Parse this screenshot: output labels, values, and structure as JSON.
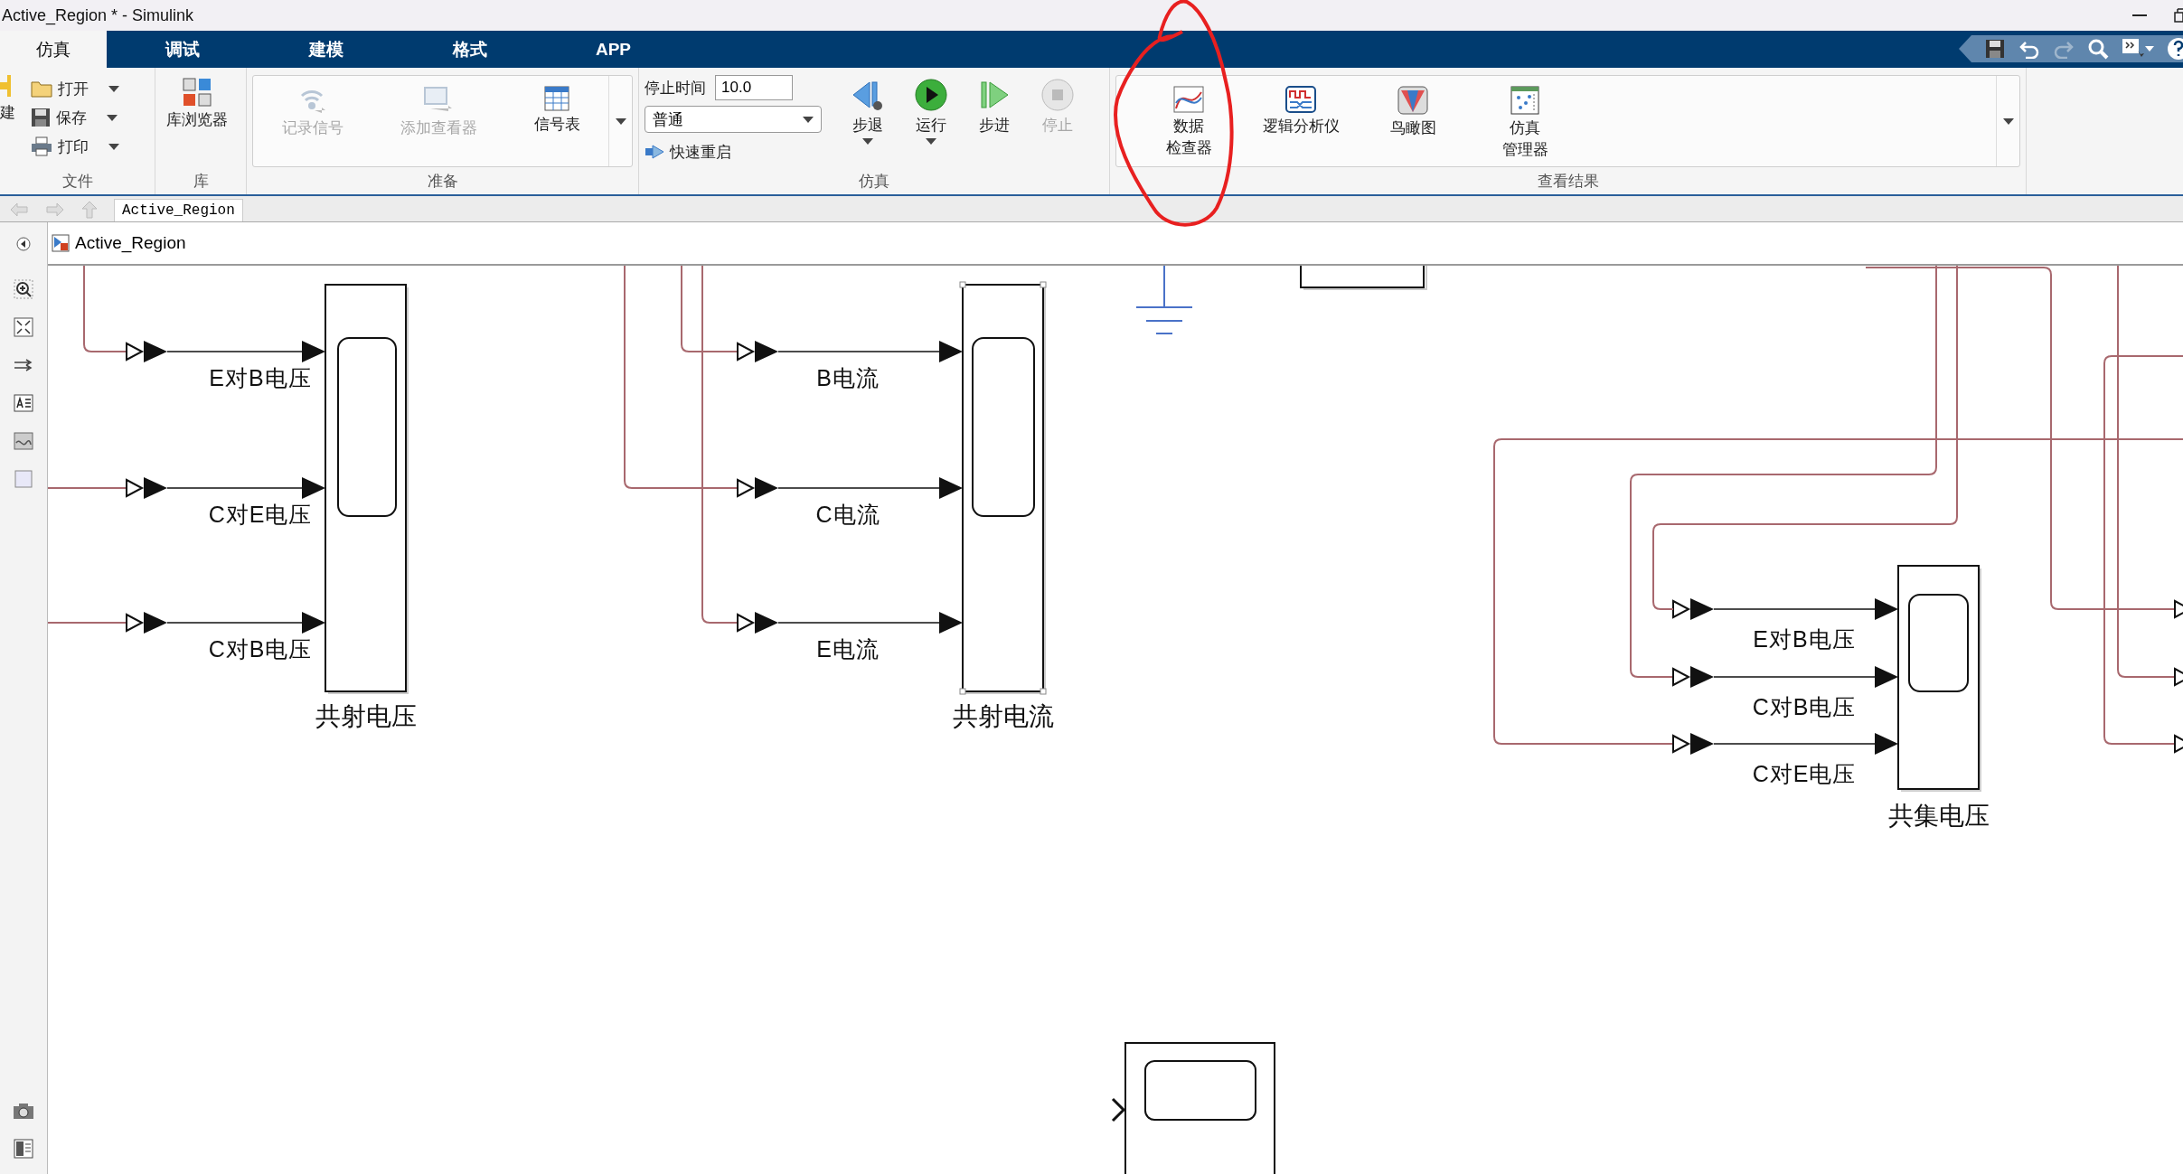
{
  "window": {
    "title": "Active_Region * - Simulink"
  },
  "tabs": [
    {
      "label": "仿真",
      "selected": true
    },
    {
      "label": "调试",
      "selected": false
    },
    {
      "label": "建模",
      "selected": false
    },
    {
      "label": "格式",
      "selected": false
    },
    {
      "label": "APP",
      "selected": false
    }
  ],
  "ribbon": {
    "groups": [
      {
        "kind": "file",
        "title": "文件",
        "new_label": "建",
        "items": [
          {
            "label": "打开",
            "kind": "open"
          },
          {
            "label": "保存",
            "kind": "save"
          },
          {
            "label": "打印",
            "kind": "print"
          }
        ]
      },
      {
        "kind": "large",
        "title": "库",
        "items": [
          {
            "label": "库浏览器",
            "kind": "library",
            "disabled": false
          }
        ]
      },
      {
        "kind": "gallery",
        "title": "准备",
        "items": [
          {
            "label": "记录信号",
            "kind": "record",
            "disabled": true
          },
          {
            "label": "添加查看器",
            "kind": "viewer",
            "disabled": true
          },
          {
            "label": "信号表",
            "kind": "table",
            "disabled": false
          }
        ]
      },
      {
        "kind": "simulation",
        "title": "仿真",
        "stop_time_label": "停止时间",
        "stop_time": "10.0",
        "mode": "普通",
        "fast_restart": "快速重启",
        "items": [
          {
            "label": "步退",
            "kind": "stepback",
            "disabled": false,
            "has_menu": true
          },
          {
            "label": "运行",
            "kind": "run",
            "disabled": false,
            "has_menu": true
          },
          {
            "label": "步进",
            "kind": "stepfwd",
            "disabled": false,
            "has_menu": false
          },
          {
            "label": "停止",
            "kind": "stop",
            "disabled": true,
            "has_menu": false
          }
        ]
      },
      {
        "kind": "gallery",
        "title": "查看结果",
        "items": [
          {
            "lines": [
              "数据",
              "检查器"
            ],
            "kind": "inspector",
            "disabled": false
          },
          {
            "lines": [
              "逻辑分析仪"
            ],
            "kind": "analyzer",
            "disabled": false
          },
          {
            "lines": [
              "鸟瞰图"
            ],
            "kind": "birdseye",
            "disabled": false
          },
          {
            "lines": [
              "仿真",
              "管理器"
            ],
            "kind": "manager",
            "disabled": false
          }
        ]
      }
    ]
  },
  "breadcrumb": {
    "tab": "Active_Region"
  },
  "address": {
    "path": "Active_Region"
  },
  "canvas": {
    "scopes": [
      {
        "title": "共射电压",
        "inputs": [
          "E对B电压",
          "C对E电压",
          "C对B电压"
        ],
        "selected": false
      },
      {
        "title": "共射电流",
        "inputs": [
          "B电流",
          "C电流",
          "E电流"
        ],
        "selected": true
      },
      {
        "title": "共集电压",
        "inputs": [
          "E对B电压",
          "C对B电压",
          "C对E电压"
        ],
        "selected": false
      }
    ]
  }
}
